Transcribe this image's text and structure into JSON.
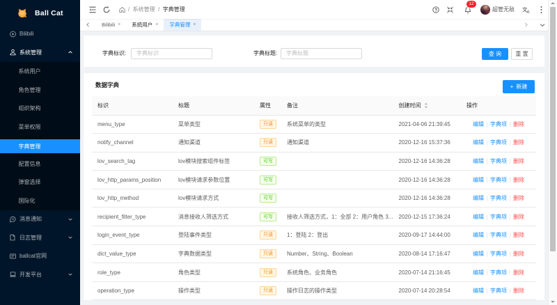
{
  "app": {
    "title": "Ball Cat"
  },
  "colors": {
    "sidebar_bg": "#001529",
    "submenu_bg": "#000c17",
    "primary": "#1890ff",
    "content_bg": "#f0f2f5",
    "danger": "#ff4d4f",
    "badge_red": "#f5222d",
    "tag_orange": "#fa8c16",
    "tag_green": "#52c41a"
  },
  "sidebar": {
    "menu": [
      {
        "label": "Bilibili",
        "icon": "play-circle-icon",
        "type": "top"
      },
      {
        "label": "系统管理",
        "icon": "user-icon",
        "type": "top",
        "open": true,
        "caret": "up",
        "children": [
          "系统用户",
          "角色管理",
          "组织架构",
          "菜单权限",
          "字典管理",
          "配置信息",
          "弹窗选择",
          "国际化"
        ],
        "selected_child": "字典管理"
      },
      {
        "label": "消息通知",
        "icon": "message-icon",
        "type": "top",
        "caret": "down"
      },
      {
        "label": "日志管理",
        "icon": "file-icon",
        "type": "top",
        "caret": "down"
      },
      {
        "label": "ballcat官网",
        "icon": "link-icon",
        "type": "top"
      },
      {
        "label": "开发平台",
        "icon": "laptop-icon",
        "type": "top",
        "caret": "down"
      }
    ]
  },
  "header": {
    "breadcrumb": {
      "home": "home-icon",
      "items": [
        "系统管理",
        "字典管理"
      ],
      "separator": "/"
    },
    "notification_count": "12",
    "username": "超管无敌"
  },
  "tabbar": {
    "tabs": [
      {
        "label": "Bilibili",
        "active": false
      },
      {
        "label": "系统用户",
        "active": false
      },
      {
        "label": "字典管理",
        "active": true
      }
    ]
  },
  "search": {
    "field1": {
      "label": "字典标识:",
      "placeholder": "字典标识",
      "value": ""
    },
    "field2": {
      "label": "字典标题:",
      "placeholder": "字典标题",
      "value": ""
    },
    "query_label": "查 询",
    "reset_label": "重 置"
  },
  "table": {
    "title": "数据字典",
    "create_label": "新建",
    "columns": [
      "标识",
      "标题",
      "属性",
      "备注",
      "创建时间",
      "操作"
    ],
    "op_labels": [
      "编辑",
      "字典项",
      "删除"
    ],
    "rows": [
      {
        "code": "menu_type",
        "title": "菜单类型",
        "attr": "只读",
        "remark": "系统菜单的类型",
        "time": "2021-04-06 21:39:45"
      },
      {
        "code": "notify_channel",
        "title": "通知渠道",
        "attr": "只读",
        "remark": "通知渠道",
        "time": "2020-12-16 15:37:36"
      },
      {
        "code": "lov_search_tag",
        "title": "lov模块搜索组件标签",
        "attr": "可写",
        "remark": "",
        "time": "2020-12-16 14:36:28"
      },
      {
        "code": "lov_http_params_position",
        "title": "lov模块请求参数位置",
        "attr": "可写",
        "remark": "",
        "time": "2020-12-16 14:36:28"
      },
      {
        "code": "lov_http_method",
        "title": "lov模块请求方式",
        "attr": "可写",
        "remark": "",
        "time": "2020-12-16 14:36:28"
      },
      {
        "code": "recipient_filter_type",
        "title": "消息接收人筛选方式",
        "attr": "可写",
        "remark": "接收人筛选方式，1：全部 2：用户角色 3...",
        "time": "2020-12-15 17:36:24"
      },
      {
        "code": "login_event_type",
        "title": "登陆事件类型",
        "attr": "只读",
        "remark": "1：登陆 2：登出",
        "time": "2020-09-17 14:44:00"
      },
      {
        "code": "dict_value_type",
        "title": "字典数据类型",
        "attr": "只读",
        "remark": "Number、String、Boolean",
        "time": "2020-08-14 17:16:47"
      },
      {
        "code": "role_type",
        "title": "角色类型",
        "attr": "只读",
        "remark": "系统角色、业务角色",
        "time": "2020-07-14 21:16:45"
      },
      {
        "code": "operation_type",
        "title": "操作类型",
        "attr": "只读",
        "remark": "操作日志的操作类型",
        "time": "2020-07-14 20:28:54"
      }
    ]
  }
}
